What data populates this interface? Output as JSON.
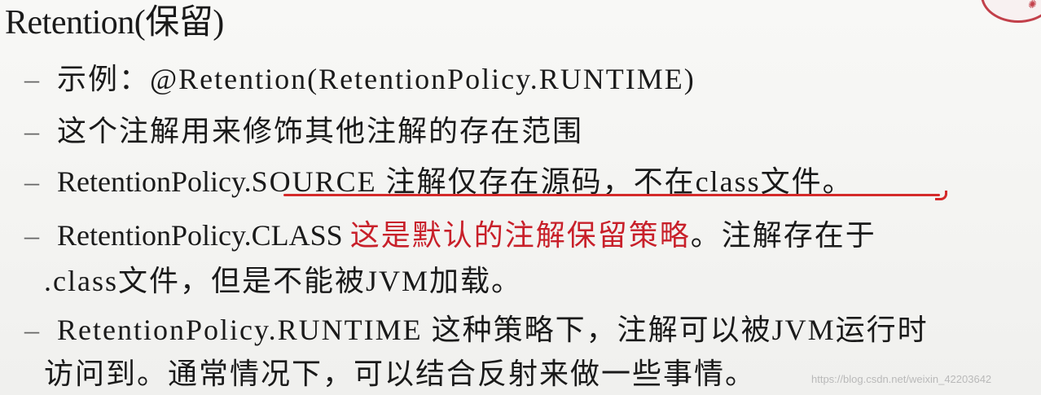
{
  "title": "Retention(保留)",
  "bullets": {
    "b1": "示例：@Retention(RetentionPolicy.RUNTIME)",
    "b2": "这个注解用来修饰其他注解的存在范围",
    "b3_prefix": "RetentionPolicy.",
    "b3_rest": "SOURCE 注解仅存在源码，不在class文件。",
    "b4_prefix": "RetentionPolicy.CLASS ",
    "b4_red": "这是默认的注解保留策略",
    "b4_suffix": "。注解存在于",
    "b4_cont": ".class文件，但是不能被JVM加载。",
    "b5": "RetentionPolicy.RUNTIME 这种策略下，注解可以被JVM运行时",
    "b5_cont": "访问到。通常情况下，可以结合反射来做一些事情。"
  },
  "dash": "–",
  "watermark": "https://blog.csdn.net/weixin_42203642",
  "colors": {
    "highlight_red": "#c8202a",
    "underline_red": "#d42a2a",
    "text": "#1a1a1a",
    "logo": "#c2404a"
  }
}
